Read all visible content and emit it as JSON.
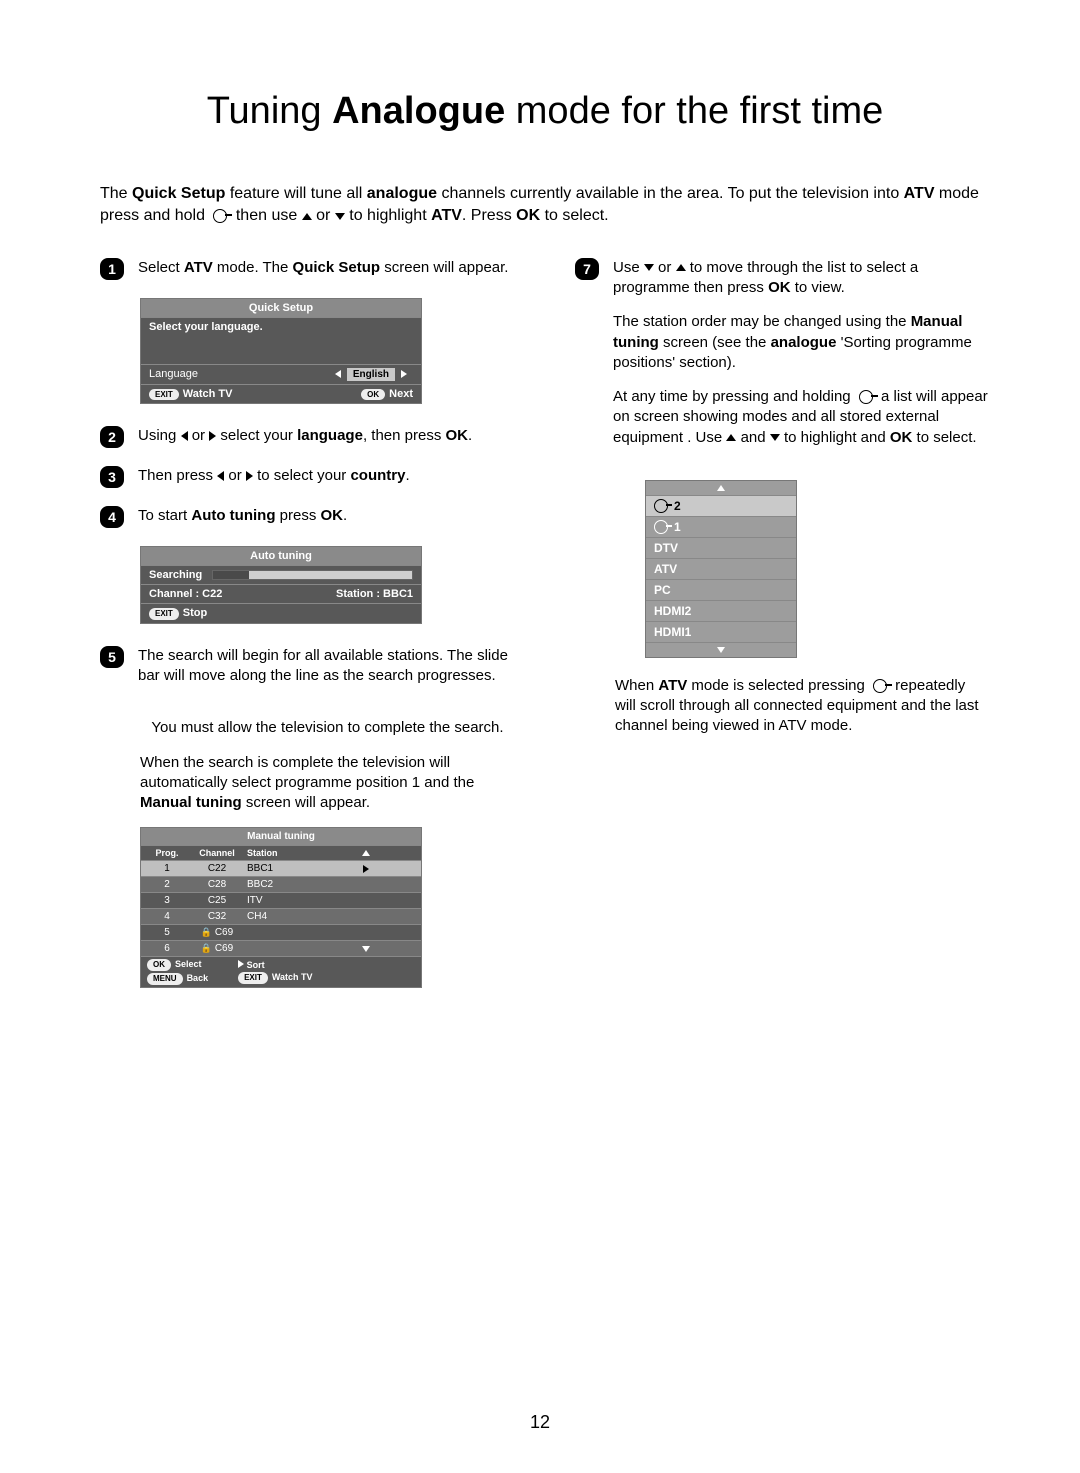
{
  "page_number": "12",
  "title": {
    "pre": "Tuning ",
    "bold": "Analogue",
    "post": " mode for the first time"
  },
  "intro": {
    "t1": "The ",
    "b1": "Quick Setup",
    "t2": " feature will tune all ",
    "b2": "analogue",
    "t3": " channels currently available in the area. To put the television into ",
    "b3": "ATV",
    "t4": " mode press and hold ",
    "t5": " then use ",
    "t6": " or ",
    "t7": " to highlight ",
    "b4": "ATV",
    "t8": ". Press ",
    "b5": "OK",
    "t9": " to select."
  },
  "steps": {
    "s1": {
      "num": "1",
      "t1": "Select ",
      "b1": "ATV",
      "t2": " mode. The ",
      "b2": "Quick Setup",
      "t3": " screen will appear."
    },
    "s2": {
      "num": "2",
      "t1": "Using ",
      "t2": " or ",
      "t3": " select your ",
      "b1": "language",
      "t4": ", then press ",
      "b2": "OK",
      "t5": "."
    },
    "s3": {
      "num": "3",
      "t1": "Then press ",
      "t2": " or ",
      "t3": " to select your ",
      "b1": "country",
      "t4": "."
    },
    "s4": {
      "num": "4",
      "t1": "To start ",
      "b1": "Auto tuning",
      "t2": " press ",
      "b2": "OK",
      "t3": "."
    },
    "s5": {
      "num": "5",
      "p1": "The search will begin for all available stations. The slide bar will move along the line as the search progresses.",
      "note": "You must allow the television to complete the search.",
      "p2a": "When the search is complete the television will automatically select programme position 1 and the ",
      "p2b": "Manual tuning",
      "p2c": " screen will appear."
    },
    "s7": {
      "num": "7",
      "p1a": "Use ",
      "p1b": " or ",
      "p1c": " to move through the list to select a programme then press ",
      "p1d": "OK",
      "p1e": " to view.",
      "p2a": "The station order may be changed using the ",
      "p2b": "Manual tuning",
      "p2c": " screen (see the ",
      "p2d": "analogue",
      "p2e": " 'Sorting programme positions' section).",
      "p3a": "At any time by pressing and holding ",
      "p3b": " a list will appear on screen showing modes and all stored external equipment . Use ",
      "p3c": " and ",
      "p3d": " to highlight and ",
      "p3e": "OK",
      "p3f": " to select.",
      "p4a": "When ",
      "p4b": "ATV",
      "p4c": " mode is selected pressing ",
      "p4d": " repeatedly will scroll through all connected equipment and the last channel being viewed in ATV mode."
    }
  },
  "quick_setup": {
    "title": "Quick Setup",
    "prompt": "Select your language.",
    "row_label": "Language",
    "row_value": "English",
    "footer": {
      "exit_badge": "EXIT",
      "exit_label": "Watch TV",
      "ok_badge": "OK",
      "ok_label": "Next"
    }
  },
  "auto_tuning": {
    "title": "Auto tuning",
    "searching_label": "Searching",
    "channel_label": "Channel  :  C22",
    "station_label": "Station : BBC1",
    "footer": {
      "exit_badge": "EXIT",
      "exit_label": "Stop"
    }
  },
  "manual_tuning": {
    "title": "Manual tuning",
    "headers": {
      "prog": "Prog.",
      "channel": "Channel",
      "station": "Station"
    },
    "rows": [
      {
        "prog": "1",
        "channel": "C22",
        "station": "BBC1",
        "lock": false
      },
      {
        "prog": "2",
        "channel": "C28",
        "station": "BBC2",
        "lock": false
      },
      {
        "prog": "3",
        "channel": "C25",
        "station": "ITV",
        "lock": false
      },
      {
        "prog": "4",
        "channel": "C32",
        "station": "CH4",
        "lock": false
      },
      {
        "prog": "5",
        "channel": "C69",
        "station": "",
        "lock": true
      },
      {
        "prog": "6",
        "channel": "C69",
        "station": "",
        "lock": true
      }
    ],
    "footer": {
      "ok_badge": "OK",
      "select_label": "Select",
      "menu_badge": "MENU",
      "back_label": "Back",
      "sort_label": "Sort",
      "exit_badge": "EXIT",
      "watch_label": "Watch TV"
    }
  },
  "mode_list": {
    "items": [
      {
        "label": "2",
        "icon": true
      },
      {
        "label": "1",
        "icon": true
      },
      {
        "label": "DTV",
        "icon": false
      },
      {
        "label": "ATV",
        "icon": false
      },
      {
        "label": "PC",
        "icon": false
      },
      {
        "label": "HDMI2",
        "icon": false
      },
      {
        "label": "HDMI1",
        "icon": false
      }
    ]
  }
}
